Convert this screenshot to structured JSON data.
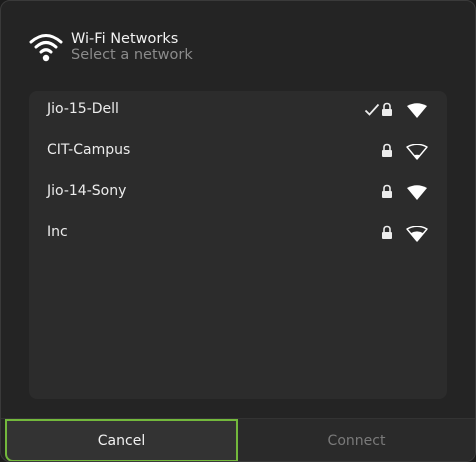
{
  "dialog": {
    "title": "Wi-Fi Networks",
    "subtitle": "Select a network",
    "header_icon": "wifi-icon"
  },
  "networks": [
    {
      "name": "Jio-15-Dell",
      "connected": true,
      "secured": true,
      "signal": "full"
    },
    {
      "name": "CIT-Campus",
      "connected": false,
      "secured": true,
      "signal": "weak"
    },
    {
      "name": "Jio-14-Sony",
      "connected": false,
      "secured": true,
      "signal": "full"
    },
    {
      "name": "Inc",
      "connected": false,
      "secured": true,
      "signal": "good"
    }
  ],
  "buttons": {
    "cancel_label": "Cancel",
    "connect_label": "Connect"
  },
  "colors": {
    "accent": "#73b83c",
    "dialog_bg": "#242424",
    "list_bg": "#2c2c2c",
    "text": "#ececec",
    "muted": "#8b8b8b"
  }
}
